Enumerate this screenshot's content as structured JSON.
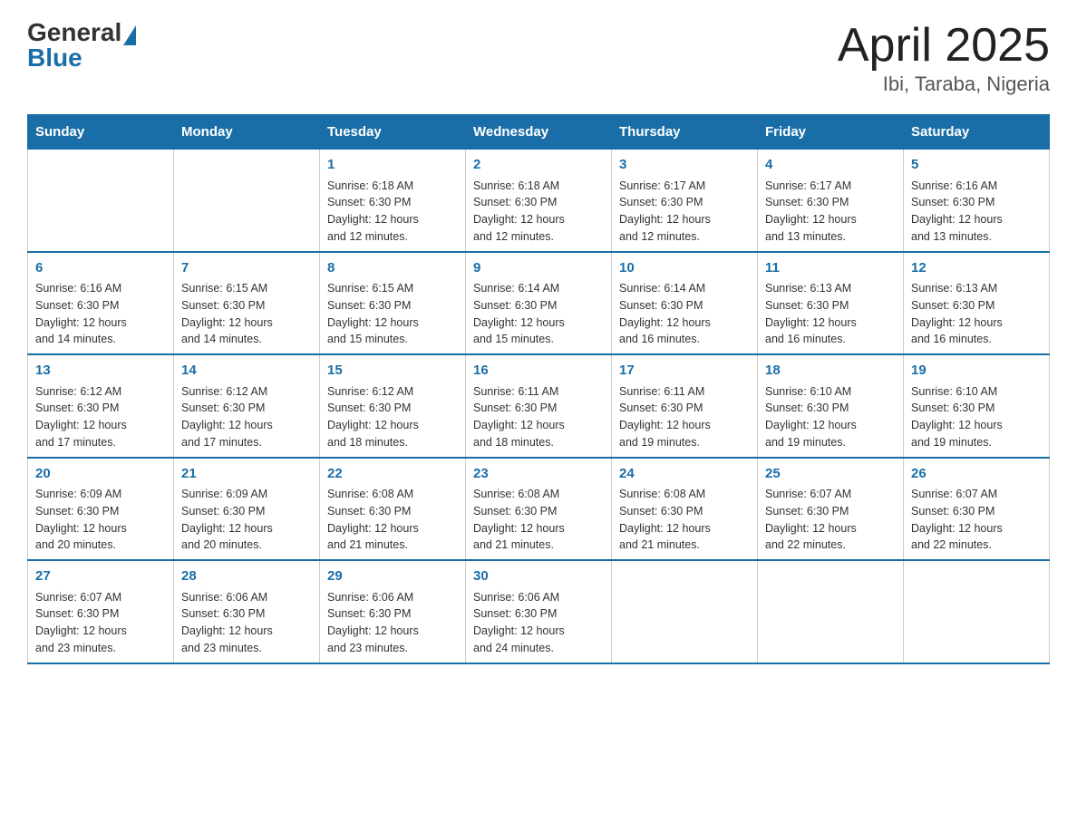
{
  "header": {
    "logo": {
      "general": "General",
      "blue": "Blue"
    },
    "title": "April 2025",
    "subtitle": "Ibi, Taraba, Nigeria"
  },
  "calendar": {
    "days_of_week": [
      "Sunday",
      "Monday",
      "Tuesday",
      "Wednesday",
      "Thursday",
      "Friday",
      "Saturday"
    ],
    "weeks": [
      [
        {
          "day": "",
          "info": ""
        },
        {
          "day": "",
          "info": ""
        },
        {
          "day": "1",
          "info": "Sunrise: 6:18 AM\nSunset: 6:30 PM\nDaylight: 12 hours\nand 12 minutes."
        },
        {
          "day": "2",
          "info": "Sunrise: 6:18 AM\nSunset: 6:30 PM\nDaylight: 12 hours\nand 12 minutes."
        },
        {
          "day": "3",
          "info": "Sunrise: 6:17 AM\nSunset: 6:30 PM\nDaylight: 12 hours\nand 12 minutes."
        },
        {
          "day": "4",
          "info": "Sunrise: 6:17 AM\nSunset: 6:30 PM\nDaylight: 12 hours\nand 13 minutes."
        },
        {
          "day": "5",
          "info": "Sunrise: 6:16 AM\nSunset: 6:30 PM\nDaylight: 12 hours\nand 13 minutes."
        }
      ],
      [
        {
          "day": "6",
          "info": "Sunrise: 6:16 AM\nSunset: 6:30 PM\nDaylight: 12 hours\nand 14 minutes."
        },
        {
          "day": "7",
          "info": "Sunrise: 6:15 AM\nSunset: 6:30 PM\nDaylight: 12 hours\nand 14 minutes."
        },
        {
          "day": "8",
          "info": "Sunrise: 6:15 AM\nSunset: 6:30 PM\nDaylight: 12 hours\nand 15 minutes."
        },
        {
          "day": "9",
          "info": "Sunrise: 6:14 AM\nSunset: 6:30 PM\nDaylight: 12 hours\nand 15 minutes."
        },
        {
          "day": "10",
          "info": "Sunrise: 6:14 AM\nSunset: 6:30 PM\nDaylight: 12 hours\nand 16 minutes."
        },
        {
          "day": "11",
          "info": "Sunrise: 6:13 AM\nSunset: 6:30 PM\nDaylight: 12 hours\nand 16 minutes."
        },
        {
          "day": "12",
          "info": "Sunrise: 6:13 AM\nSunset: 6:30 PM\nDaylight: 12 hours\nand 16 minutes."
        }
      ],
      [
        {
          "day": "13",
          "info": "Sunrise: 6:12 AM\nSunset: 6:30 PM\nDaylight: 12 hours\nand 17 minutes."
        },
        {
          "day": "14",
          "info": "Sunrise: 6:12 AM\nSunset: 6:30 PM\nDaylight: 12 hours\nand 17 minutes."
        },
        {
          "day": "15",
          "info": "Sunrise: 6:12 AM\nSunset: 6:30 PM\nDaylight: 12 hours\nand 18 minutes."
        },
        {
          "day": "16",
          "info": "Sunrise: 6:11 AM\nSunset: 6:30 PM\nDaylight: 12 hours\nand 18 minutes."
        },
        {
          "day": "17",
          "info": "Sunrise: 6:11 AM\nSunset: 6:30 PM\nDaylight: 12 hours\nand 19 minutes."
        },
        {
          "day": "18",
          "info": "Sunrise: 6:10 AM\nSunset: 6:30 PM\nDaylight: 12 hours\nand 19 minutes."
        },
        {
          "day": "19",
          "info": "Sunrise: 6:10 AM\nSunset: 6:30 PM\nDaylight: 12 hours\nand 19 minutes."
        }
      ],
      [
        {
          "day": "20",
          "info": "Sunrise: 6:09 AM\nSunset: 6:30 PM\nDaylight: 12 hours\nand 20 minutes."
        },
        {
          "day": "21",
          "info": "Sunrise: 6:09 AM\nSunset: 6:30 PM\nDaylight: 12 hours\nand 20 minutes."
        },
        {
          "day": "22",
          "info": "Sunrise: 6:08 AM\nSunset: 6:30 PM\nDaylight: 12 hours\nand 21 minutes."
        },
        {
          "day": "23",
          "info": "Sunrise: 6:08 AM\nSunset: 6:30 PM\nDaylight: 12 hours\nand 21 minutes."
        },
        {
          "day": "24",
          "info": "Sunrise: 6:08 AM\nSunset: 6:30 PM\nDaylight: 12 hours\nand 21 minutes."
        },
        {
          "day": "25",
          "info": "Sunrise: 6:07 AM\nSunset: 6:30 PM\nDaylight: 12 hours\nand 22 minutes."
        },
        {
          "day": "26",
          "info": "Sunrise: 6:07 AM\nSunset: 6:30 PM\nDaylight: 12 hours\nand 22 minutes."
        }
      ],
      [
        {
          "day": "27",
          "info": "Sunrise: 6:07 AM\nSunset: 6:30 PM\nDaylight: 12 hours\nand 23 minutes."
        },
        {
          "day": "28",
          "info": "Sunrise: 6:06 AM\nSunset: 6:30 PM\nDaylight: 12 hours\nand 23 minutes."
        },
        {
          "day": "29",
          "info": "Sunrise: 6:06 AM\nSunset: 6:30 PM\nDaylight: 12 hours\nand 23 minutes."
        },
        {
          "day": "30",
          "info": "Sunrise: 6:06 AM\nSunset: 6:30 PM\nDaylight: 12 hours\nand 24 minutes."
        },
        {
          "day": "",
          "info": ""
        },
        {
          "day": "",
          "info": ""
        },
        {
          "day": "",
          "info": ""
        }
      ]
    ]
  }
}
